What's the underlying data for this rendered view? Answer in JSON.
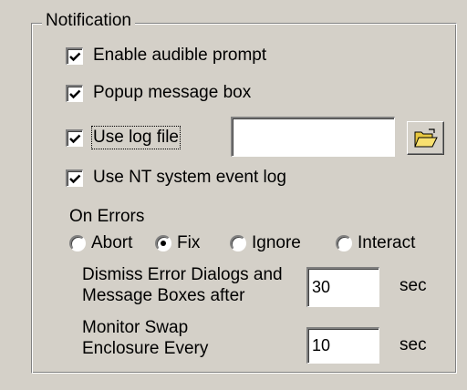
{
  "group": {
    "title": "Notification"
  },
  "checkboxes": {
    "audible": {
      "label": "Enable audible prompt",
      "checked": true
    },
    "popup": {
      "label": "Popup message box",
      "checked": true
    },
    "logfile": {
      "label": "Use log file",
      "checked": true
    },
    "nt_event": {
      "label": "Use NT system event log",
      "checked": true
    }
  },
  "logfile_path": {
    "value": ""
  },
  "folder_button": {
    "icon": "folder-open-icon"
  },
  "on_errors": {
    "label": "On Errors",
    "options": [
      {
        "label": "Abort",
        "selected": false
      },
      {
        "label": "Fix",
        "selected": true
      },
      {
        "label": "Ignore",
        "selected": false
      },
      {
        "label": "Interact",
        "selected": false
      }
    ]
  },
  "dismiss": {
    "label_line1": "Dismiss Error Dialogs and",
    "label_line2": "Message Boxes after",
    "value": "30",
    "unit": "sec"
  },
  "monitor": {
    "label_line1": "Monitor Swap",
    "label_line2": "Enclosure Every",
    "value": "10",
    "unit": "sec"
  }
}
